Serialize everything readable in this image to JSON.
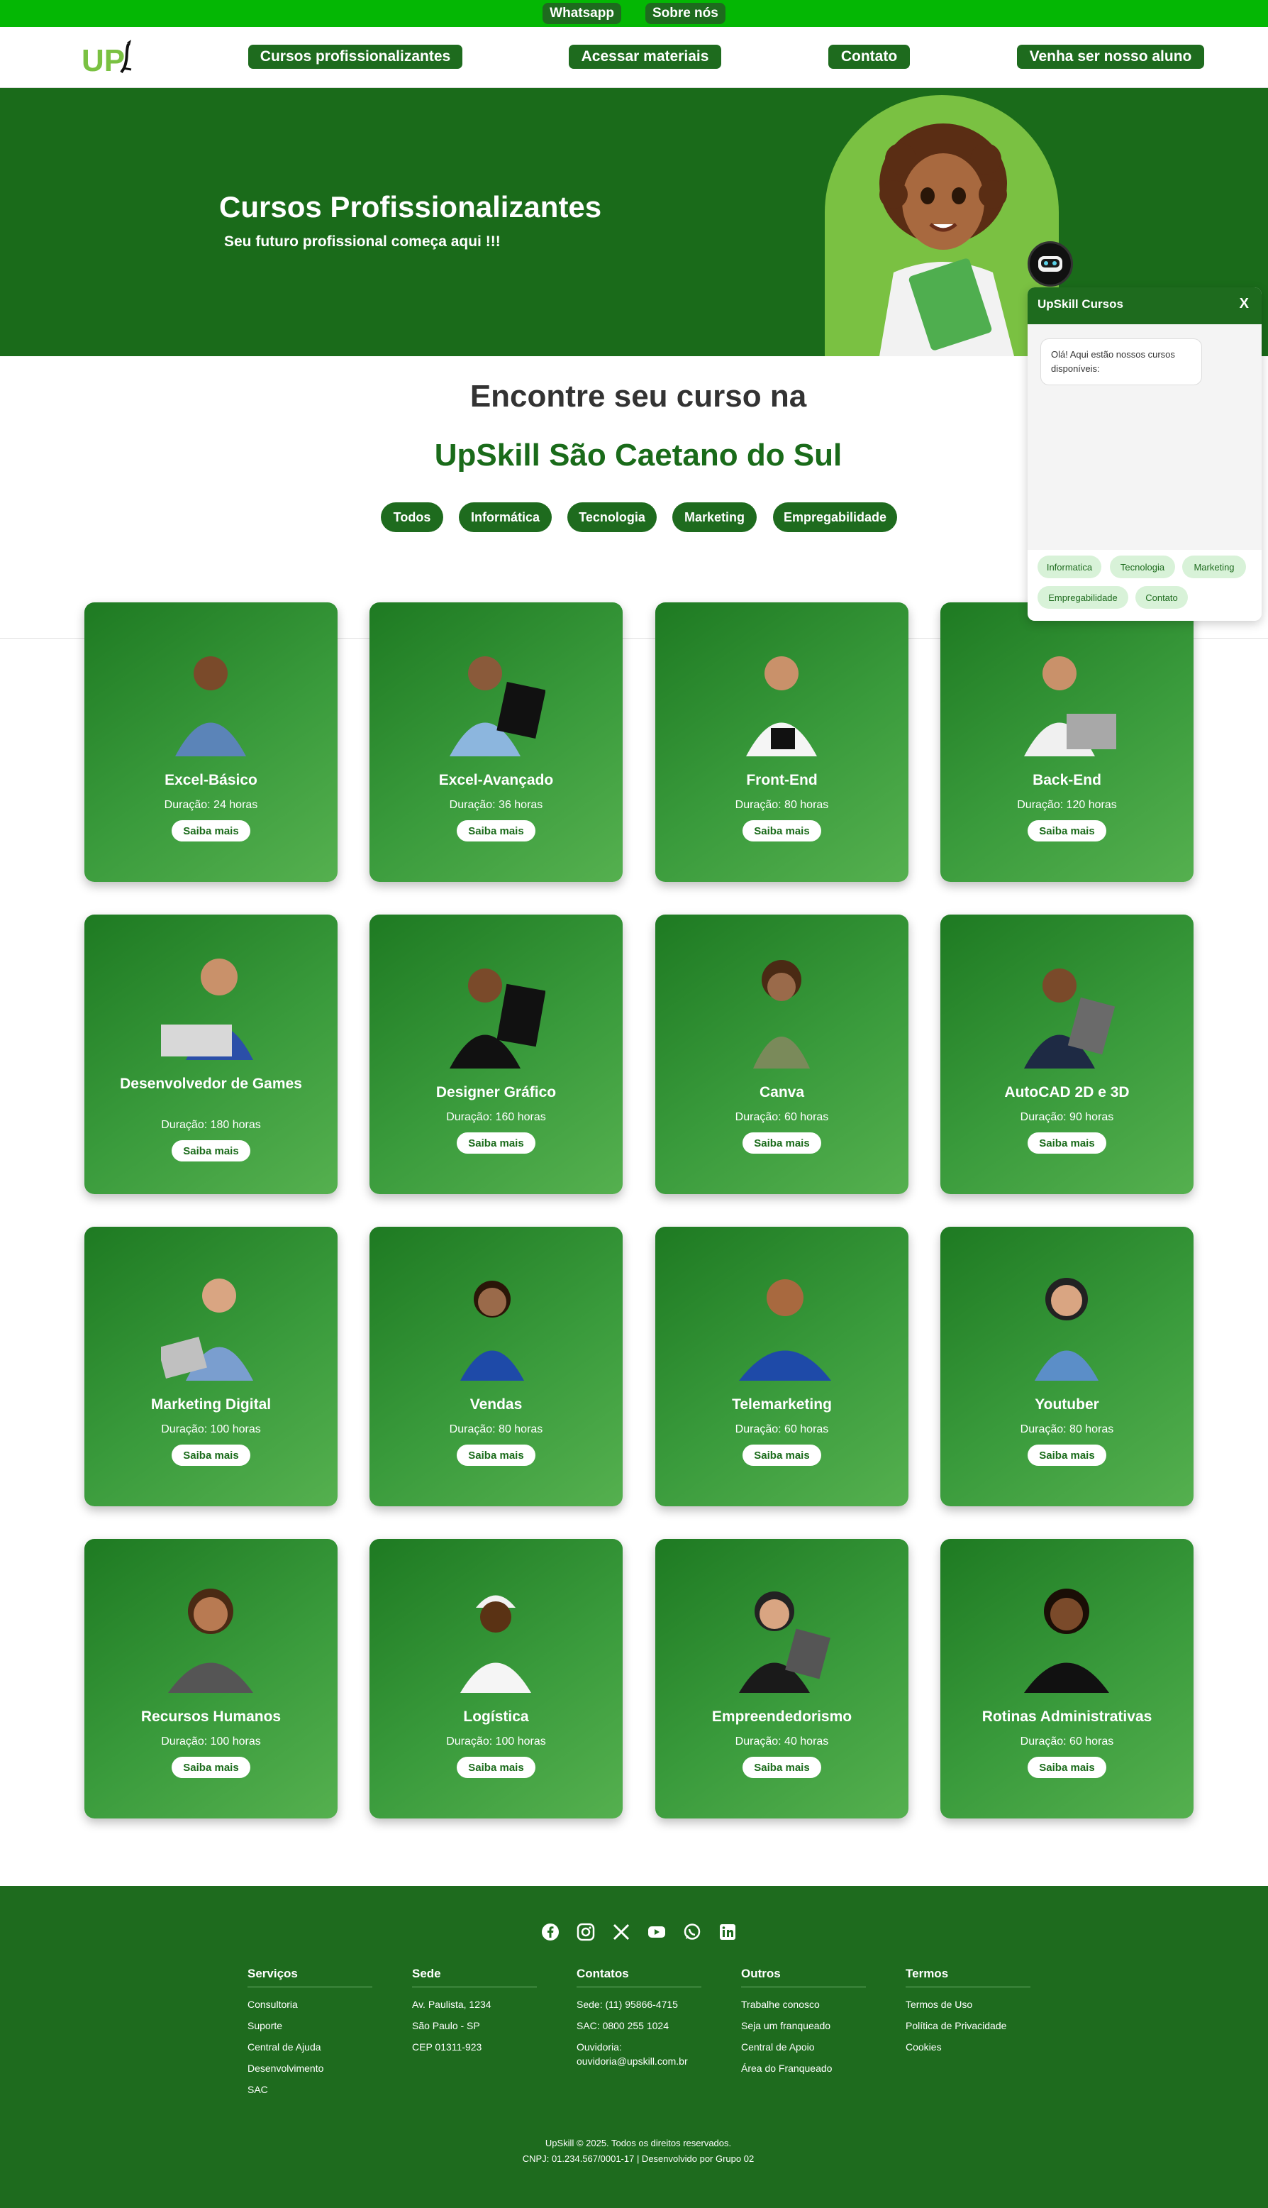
{
  "topbar": {
    "whatsapp": "Whatsapp",
    "about": "Sobre nós"
  },
  "header": {
    "logo_text": "UP",
    "nav": [
      "Cursos profissionalizantes",
      "Acessar materiais",
      "Contato",
      "Venha ser nosso aluno"
    ]
  },
  "hero": {
    "title": "Cursos Profissionalizantes",
    "subtitle": "Seu futuro profissional começa aqui !!!"
  },
  "section": {
    "heading_line1": "Encontre seu curso na",
    "heading_line2": "UpSkill São Caetano do Sul",
    "filters": [
      "Todos",
      "Informática",
      "Tecnologia",
      "Marketing",
      "Empregabilidade"
    ]
  },
  "courses": [
    {
      "title": "Excel-Básico",
      "duration": "Duração: 24 horas",
      "button": "Saiba mais"
    },
    {
      "title": "Excel-Avançado",
      "duration": "Duração: 36 horas",
      "button": "Saiba mais"
    },
    {
      "title": "Front-End",
      "duration": "Duração: 80 horas",
      "button": "Saiba mais"
    },
    {
      "title": "Back-End",
      "duration": "Duração: 120 horas",
      "button": "Saiba mais"
    },
    {
      "title": "Desenvolvedor de Games",
      "duration": "Duração: 180 horas",
      "button": "Saiba mais"
    },
    {
      "title": "Designer Gráfico",
      "duration": "Duração: 160 horas",
      "button": "Saiba mais"
    },
    {
      "title": "Canva",
      "duration": "Duração: 60 horas",
      "button": "Saiba mais"
    },
    {
      "title": "AutoCAD 2D e 3D",
      "duration": "Duração: 90 horas",
      "button": "Saiba mais"
    },
    {
      "title": "Marketing Digital",
      "duration": "Duração: 100 horas",
      "button": "Saiba mais"
    },
    {
      "title": "Vendas",
      "duration": "Duração: 80 horas",
      "button": "Saiba mais"
    },
    {
      "title": "Telemarketing",
      "duration": "Duração: 60 horas",
      "button": "Saiba mais"
    },
    {
      "title": "Youtuber",
      "duration": "Duração: 80 horas",
      "button": "Saiba mais"
    },
    {
      "title": "Recursos Humanos",
      "duration": "Duração: 100 horas",
      "button": "Saiba mais"
    },
    {
      "title": "Logística",
      "duration": "Duração: 100 horas",
      "button": "Saiba mais"
    },
    {
      "title": "Empreendedorismo",
      "duration": "Duração: 40 horas",
      "button": "Saiba mais"
    },
    {
      "title": "Rotinas Administrativas",
      "duration": "Duração: 60 horas",
      "button": "Saiba mais"
    }
  ],
  "chat": {
    "title": "UpSkill Cursos",
    "close": "X",
    "message": "Olá! Aqui estão nossos cursos disponíveis:",
    "chips": [
      "Informatica",
      "Tecnologia",
      "Marketing",
      "Empregabilidade",
      "Contato"
    ]
  },
  "footer": {
    "social_icons": [
      "facebook-icon",
      "instagram-icon",
      "x-icon",
      "youtube-icon",
      "whatsapp-icon",
      "linkedin-icon"
    ],
    "columns": [
      {
        "title": "Serviços",
        "items": [
          "Consultoria",
          "Suporte",
          "Central de Ajuda",
          "Desenvolvimento",
          "SAC"
        ]
      },
      {
        "title": "Sede",
        "items": [
          "Av. Paulista, 1234",
          "São Paulo - SP",
          "CEP 01311-923"
        ]
      },
      {
        "title": "Contatos",
        "items": [
          "Sede: (11) 95866-4715",
          "SAC: 0800 255 1024",
          "Ouvidoria: ouvidoria@upskill.com.br"
        ]
      },
      {
        "title": "Outros",
        "items": [
          "Trabalhe conosco",
          "Seja um franqueado",
          "Central de Apoio",
          "Área do Franqueado"
        ]
      },
      {
        "title": "Termos",
        "items": [
          "Termos de Uso",
          "Política de Privacidade",
          "Cookies"
        ]
      }
    ],
    "copyright": "UpSkill © 2025. Todos os direitos reservados.",
    "cnpj": "CNPJ: 01.234.567/0001-17 | Desenvolvido por Grupo 02"
  },
  "colors": {
    "topbar": "#04b704",
    "primary": "#1e6b1e",
    "hero": "#1a6b1a",
    "accent": "#7ac142"
  }
}
